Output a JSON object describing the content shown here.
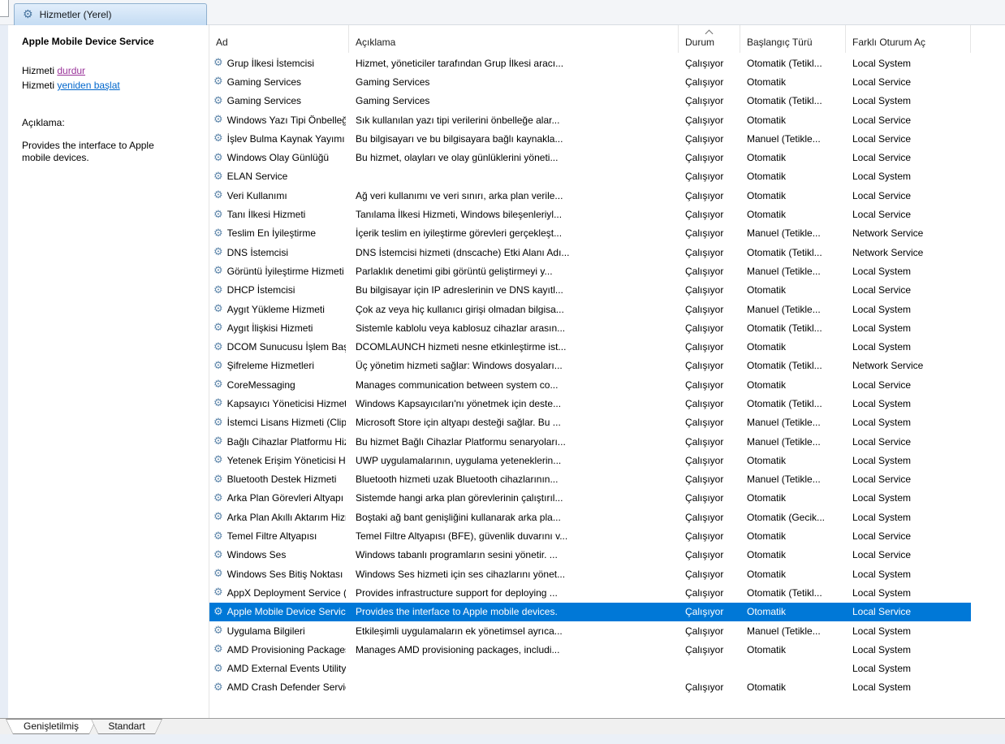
{
  "colors": {
    "selection_bg": "#0078d7",
    "selection_text": "#ffffff",
    "stop_link": "#993399",
    "restart_link": "#0066cc"
  },
  "icons": {
    "service_gear": "⚙",
    "sort_direction": "ascending"
  },
  "console": {
    "top_tab": "Hizmetler (Yerel)"
  },
  "sidebar": {
    "selected_service_title": "Apple Mobile Device Service",
    "stop_prefix": "Hizmeti ",
    "stop_link": "durdur",
    "restart_prefix": "Hizmeti ",
    "restart_link": "yeniden başlat",
    "description_label": "Açıklama:",
    "description_text": "Provides the interface to Apple mobile devices."
  },
  "table": {
    "columns": [
      "Ad",
      "Açıklama",
      "Durum",
      "Başlangıç Türü",
      "Farklı Oturum Aç"
    ],
    "sort_column": "Durum",
    "rows": [
      {
        "name": "Grup İlkesi İstemcisi",
        "desc": "Hizmet, yöneticiler tarafından Grup İlkesi aracı...",
        "status": "Çalışıyor",
        "startup": "Otomatik (Tetikl...",
        "logon": "Local System"
      },
      {
        "name": "Gaming Services",
        "desc": "Gaming Services",
        "status": "Çalışıyor",
        "startup": "Otomatik",
        "logon": "Local Service"
      },
      {
        "name": "Gaming Services",
        "desc": "Gaming Services",
        "status": "Çalışıyor",
        "startup": "Otomatik (Tetikl...",
        "logon": "Local System"
      },
      {
        "name": "Windows Yazı Tipi Önbelleği...",
        "desc": "Sık kullanılan yazı tipi verilerini önbelleğe alar...",
        "status": "Çalışıyor",
        "startup": "Otomatik",
        "logon": "Local Service"
      },
      {
        "name": "İşlev Bulma Kaynak Yayımı",
        "desc": "Bu bilgisayarı ve bu bilgisayara bağlı kaynakla...",
        "status": "Çalışıyor",
        "startup": "Manuel (Tetikle...",
        "logon": "Local Service"
      },
      {
        "name": "Windows Olay Günlüğü",
        "desc": "Bu hizmet, olayları ve olay günlüklerini yöneti...",
        "status": "Çalışıyor",
        "startup": "Otomatik",
        "logon": "Local Service"
      },
      {
        "name": "ELAN Service",
        "desc": "",
        "status": "Çalışıyor",
        "startup": "Otomatik",
        "logon": "Local System"
      },
      {
        "name": "Veri Kullanımı",
        "desc": "Ağ veri kullanımı ve veri sınırı, arka plan verile...",
        "status": "Çalışıyor",
        "startup": "Otomatik",
        "logon": "Local Service"
      },
      {
        "name": "Tanı İlkesi Hizmeti",
        "desc": "Tanılama İlkesi Hizmeti, Windows bileşenleriyl...",
        "status": "Çalışıyor",
        "startup": "Otomatik",
        "logon": "Local Service"
      },
      {
        "name": "Teslim En İyileştirme",
        "desc": "İçerik teslim en iyileştirme görevleri gerçekleşt...",
        "status": "Çalışıyor",
        "startup": "Manuel (Tetikle...",
        "logon": "Network Service"
      },
      {
        "name": "DNS İstemcisi",
        "desc": "DNS İstemcisi hizmeti (dnscache) Etki Alanı Adı...",
        "status": "Çalışıyor",
        "startup": "Otomatik (Tetikl...",
        "logon": "Network Service"
      },
      {
        "name": "Görüntü İyileştirme Hizmeti",
        "desc": "Parlaklık denetimi gibi görüntü geliştirmeyi y...",
        "status": "Çalışıyor",
        "startup": "Manuel (Tetikle...",
        "logon": "Local System"
      },
      {
        "name": "DHCP İstemcisi",
        "desc": "Bu bilgisayar için IP adreslerinin ve DNS kayıtl...",
        "status": "Çalışıyor",
        "startup": "Otomatik",
        "logon": "Local Service"
      },
      {
        "name": "Aygıt Yükleme Hizmeti",
        "desc": "Çok az veya hiç kullanıcı girişi olmadan bilgisa...",
        "status": "Çalışıyor",
        "startup": "Manuel (Tetikle...",
        "logon": "Local System"
      },
      {
        "name": "Aygıt İlişkisi Hizmeti",
        "desc": "Sistemle kablolu veya kablosuz cihazlar arasın...",
        "status": "Çalışıyor",
        "startup": "Otomatik (Tetikl...",
        "logon": "Local System"
      },
      {
        "name": "DCOM Sunucusu İşlem Başl...",
        "desc": "DCOMLAUNCH hizmeti nesne etkinleştirme ist...",
        "status": "Çalışıyor",
        "startup": "Otomatik",
        "logon": "Local System"
      },
      {
        "name": "Şifreleme Hizmetleri",
        "desc": "Üç yönetim hizmeti sağlar: Windows dosyaları...",
        "status": "Çalışıyor",
        "startup": "Otomatik (Tetikl...",
        "logon": "Network Service"
      },
      {
        "name": "CoreMessaging",
        "desc": "Manages communication between system co...",
        "status": "Çalışıyor",
        "startup": "Otomatik",
        "logon": "Local Service"
      },
      {
        "name": "Kapsayıcı Yöneticisi Hizmeti",
        "desc": "Windows Kapsayıcıları'nı yönetmek için deste...",
        "status": "Çalışıyor",
        "startup": "Otomatik (Tetikl...",
        "logon": "Local System"
      },
      {
        "name": "İstemci Lisans Hizmeti (ClipS...",
        "desc": "Microsoft Store için altyapı desteği sağlar. Bu ...",
        "status": "Çalışıyor",
        "startup": "Manuel (Tetikle...",
        "logon": "Local System"
      },
      {
        "name": "Bağlı Cihazlar Platformu Hiz...",
        "desc": "Bu hizmet Bağlı Cihazlar Platformu senaryoları...",
        "status": "Çalışıyor",
        "startup": "Manuel (Tetikle...",
        "logon": "Local Service"
      },
      {
        "name": "Yetenek Erişim Yöneticisi Hiz...",
        "desc": "UWP uygulamalarının, uygulama yeteneklerin...",
        "status": "Çalışıyor",
        "startup": "Otomatik",
        "logon": "Local System"
      },
      {
        "name": "Bluetooth Destek Hizmeti",
        "desc": "Bluetooth hizmeti uzak Bluetooth cihazlarının...",
        "status": "Çalışıyor",
        "startup": "Manuel (Tetikle...",
        "logon": "Local Service"
      },
      {
        "name": "Arka Plan Görevleri Altyapı H...",
        "desc": "Sistemde hangi arka plan görevlerinin çalıştırıl...",
        "status": "Çalışıyor",
        "startup": "Otomatik",
        "logon": "Local System"
      },
      {
        "name": "Arka Plan Akıllı Aktarım Hizm...",
        "desc": "Boştaki ağ bant genişliğini kullanarak arka pla...",
        "status": "Çalışıyor",
        "startup": "Otomatik (Gecik...",
        "logon": "Local System"
      },
      {
        "name": "Temel Filtre Altyapısı",
        "desc": "Temel Filtre Altyapısı (BFE), güvenlik duvarını v...",
        "status": "Çalışıyor",
        "startup": "Otomatik",
        "logon": "Local Service"
      },
      {
        "name": "Windows Ses",
        "desc": "Windows tabanlı programların sesini yönetir.  ...",
        "status": "Çalışıyor",
        "startup": "Otomatik",
        "logon": "Local Service"
      },
      {
        "name": "Windows Ses Bitiş Noktası O...",
        "desc": "Windows Ses hizmeti için ses cihazlarını yönet...",
        "status": "Çalışıyor",
        "startup": "Otomatik",
        "logon": "Local System"
      },
      {
        "name": "AppX Deployment Service (A...",
        "desc": "Provides infrastructure support for deploying ...",
        "status": "Çalışıyor",
        "startup": "Otomatik (Tetikl...",
        "logon": "Local System"
      },
      {
        "name": "Apple Mobile Device Service",
        "desc": "Provides the interface to Apple mobile devices.",
        "status": "Çalışıyor",
        "startup": "Otomatik",
        "logon": "Local Service",
        "selected": true
      },
      {
        "name": "Uygulama Bilgileri",
        "desc": "Etkileşimli uygulamaların ek yönetimsel ayrıca...",
        "status": "Çalışıyor",
        "startup": "Manuel (Tetikle...",
        "logon": "Local System"
      },
      {
        "name": "AMD Provisioning Packages ...",
        "desc": "Manages AMD provisioning packages, includi...",
        "status": "Çalışıyor",
        "startup": "Otomatik",
        "logon": "Local System"
      },
      {
        "name": "AMD External Events Utility",
        "desc": "",
        "status": "",
        "startup": "",
        "logon": "Local System"
      },
      {
        "name": "AMD Crash Defender Service",
        "desc": "",
        "status": "Çalışıyor",
        "startup": "Otomatik",
        "logon": "Local System"
      }
    ]
  },
  "bottom_tabs": [
    {
      "label": "Genişletilmiş",
      "active": true
    },
    {
      "label": "Standart",
      "active": false
    }
  ]
}
